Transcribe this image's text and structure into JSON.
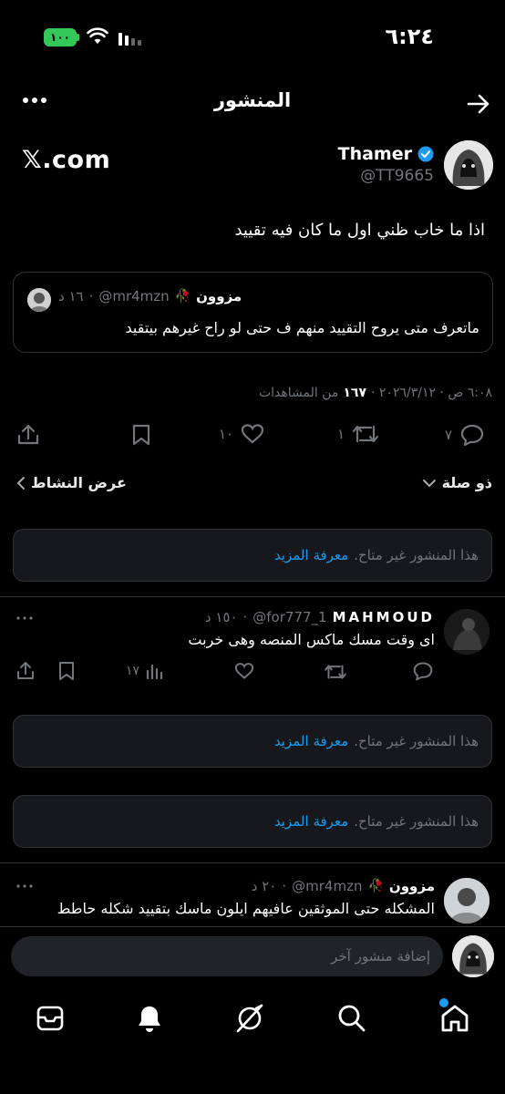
{
  "status_bar": {
    "time": "٦:٢٤",
    "battery": "١٠٠"
  },
  "header": {
    "title": "المنشور"
  },
  "post": {
    "display_name": "Thamer",
    "handle": "@TT9665",
    "watermark": "𝕏.com",
    "text": "اذا ما خاب ظني اول ما كان فيه تقييد",
    "quote": {
      "name": "مزوون",
      "handle": "@mr4mzn",
      "time": "١٦ د",
      "text": "ماتعرف متى يروح التقييد منهم ف حتى لو راح غيرهم بيتقيد"
    },
    "meta": "٦:٠٨ ص · ٢٠٢٦/٣/١٢ ·",
    "views_count": "١٦٧",
    "views_label": "من المشاهدات",
    "replies": "٧",
    "reposts": "١",
    "likes": "١٠"
  },
  "sort": {
    "relevance": "ذو صلة",
    "activity": "عرض النشاط"
  },
  "unavailable": {
    "text": "هذا المنشور غير متاح.",
    "link": "معرفة المزيد"
  },
  "reply1": {
    "name": "MAHMOUD",
    "handle": "@for777_1",
    "time": "١٥٠ د",
    "text": "اى وقت مسك ماكس المنصه وهى خربت",
    "views": "١٧"
  },
  "reply2": {
    "name": "مزوون",
    "handle": "@mr4mzn",
    "time": "٢٠ د",
    "text": "المشكله حتى الموثقين عافيهم ايلون ماسك بتقييد شكله حاطط"
  },
  "compose": {
    "placeholder": "إضافة منشور آخر"
  },
  "colors": {
    "accent": "#1d9bf0",
    "background": "#000000",
    "card": "#16181c",
    "border": "#2f3336",
    "muted": "#71767b"
  }
}
